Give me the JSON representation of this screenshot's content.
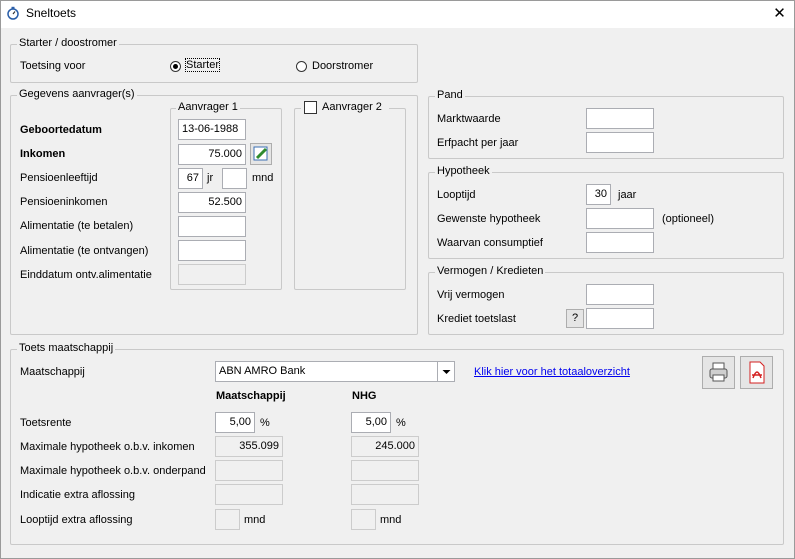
{
  "window": {
    "title": "Sneltoets",
    "close_glyph": "✕"
  },
  "starter": {
    "legend": "Starter / doostromer",
    "toetsing_label": "Toetsing voor",
    "option_starter": "Starter",
    "option_doorstromer": "Doorstromer",
    "selected": "Starter"
  },
  "aanvrager": {
    "legend": "Gegevens aanvrager(s)",
    "col1_title": "Aanvrager 1",
    "col2_title": "Aanvrager 2",
    "col2_checked": false,
    "geboortedatum_label": "Geboortedatum",
    "geboortedatum_value": "13-06-1988",
    "inkomen_label": "Inkomen",
    "inkomen_value": "75.000",
    "pensioenleeftijd_label": "Pensioenleeftijd",
    "pensioenleeftijd_jr": "67",
    "jr_unit": "jr",
    "pensioenleeftijd_mnd": "",
    "mnd_unit": "mnd",
    "pensioeninkomen_label": "Pensioeninkomen",
    "pensioeninkomen_value": "52.500",
    "alim_betalen_label": "Alimentatie (te betalen)",
    "alim_betalen_value": "",
    "alim_ontvangen_label": "Alimentatie (te ontvangen)",
    "alim_ontvangen_value": "",
    "einddatum_label": "Einddatum ontv.alimentatie",
    "einddatum_value": ""
  },
  "pand": {
    "legend": "Pand",
    "marktwaarde_label": "Marktwaarde",
    "marktwaarde_value": "",
    "erfpacht_label": "Erfpacht per jaar",
    "erfpacht_value": ""
  },
  "hypotheek": {
    "legend": "Hypotheek",
    "looptijd_label": "Looptijd",
    "looptijd_value": "30",
    "looptijd_unit": "jaar",
    "gewenste_label": "Gewenste hypotheek",
    "gewenste_value": "",
    "gewenste_note": "(optioneel)",
    "consumptief_label": "Waarvan consumptief",
    "consumptief_value": ""
  },
  "vermogen": {
    "legend": "Vermogen / Kredieten",
    "vrij_label": "Vrij vermogen",
    "vrij_value": "",
    "krediet_label": "Krediet toetslast",
    "krediet_help": "?",
    "krediet_value": ""
  },
  "toets": {
    "legend": "Toets maatschappij",
    "maatschappij_label": "Maatschappij",
    "maatschappij_value": "ABN AMRO Bank",
    "totaal_link": "Klik hier voor het totaaloverzicht",
    "col_maatschappij": "Maatschappij",
    "col_nhg": "NHG",
    "toetsrente_label": "Toetsrente",
    "toetsrente_m": "5,00",
    "toetsrente_n": "5,00",
    "pct": "%",
    "max_inkomen_label": "Maximale hypotheek o.b.v. inkomen",
    "max_inkomen_m": "355.099",
    "max_inkomen_n": "245.000",
    "max_onderpand_label": "Maximale hypotheek o.b.v. onderpand",
    "max_onderpand_m": "",
    "max_onderpand_n": "",
    "extra_aflossing_label": "Indicatie extra aflossing",
    "extra_aflossing_m": "",
    "extra_aflossing_n": "",
    "looptijd_extra_label": "Looptijd extra aflossing",
    "looptijd_extra_m": "",
    "looptijd_extra_n": "",
    "mnd_unit": "mnd"
  },
  "colors": {
    "link": "#0000ee",
    "pdf_red": "#d42020",
    "edit_green": "#2e8b2e"
  }
}
